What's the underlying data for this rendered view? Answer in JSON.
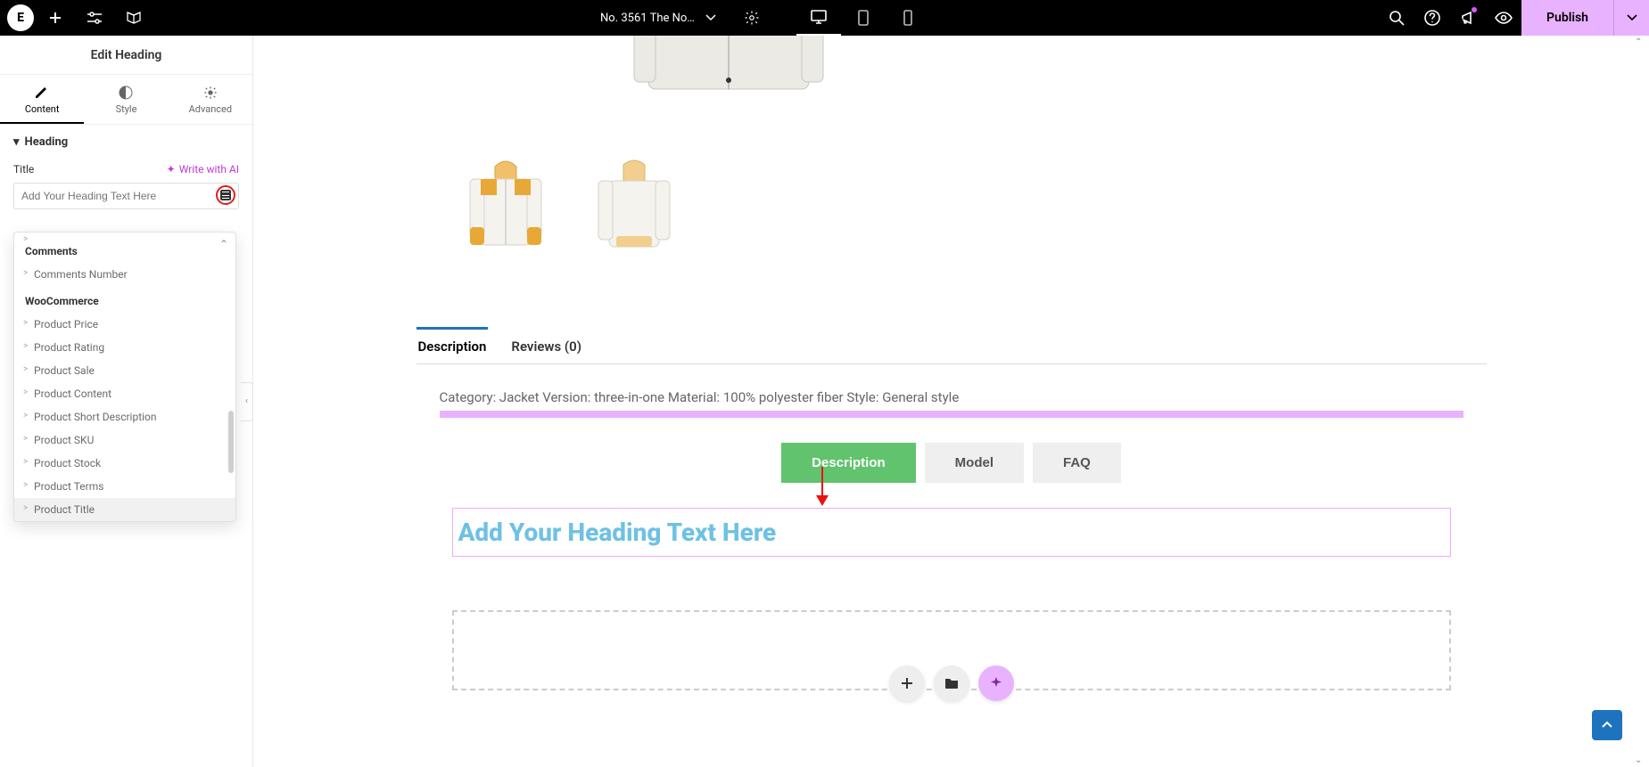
{
  "topbar": {
    "page_title": "No. 3561 The No…",
    "publish_label": "Publish"
  },
  "panel": {
    "title": "Edit Heading",
    "tab_content": "Content",
    "tab_style": "Style",
    "tab_advanced": "Advanced",
    "section_heading": "Heading",
    "field_title_label": "Title",
    "write_ai": "Write with AI",
    "title_placeholder": "Add Your Heading Text Here"
  },
  "dynamic_dropdown": {
    "truncated_item": "",
    "group1_title": "Comments",
    "group1_items": [
      "Comments Number"
    ],
    "group2_title": "WooCommerce",
    "group2_items": [
      "Product Price",
      "Product Rating",
      "Product Sale",
      "Product Content",
      "Product Short Description",
      "Product SKU",
      "Product Stock",
      "Product Terms",
      "Product Title"
    ]
  },
  "canvas": {
    "wc_tab_desc": "Description",
    "wc_tab_reviews": "Reviews (0)",
    "desc_text": "Category: Jacket Version: three-in-one Material: 100% polyester fiber Style: General style",
    "inline_tabs": {
      "desc": "Description",
      "model": "Model",
      "faq": "FAQ"
    },
    "heading_placeholder": "Add Your Heading Text Here"
  }
}
